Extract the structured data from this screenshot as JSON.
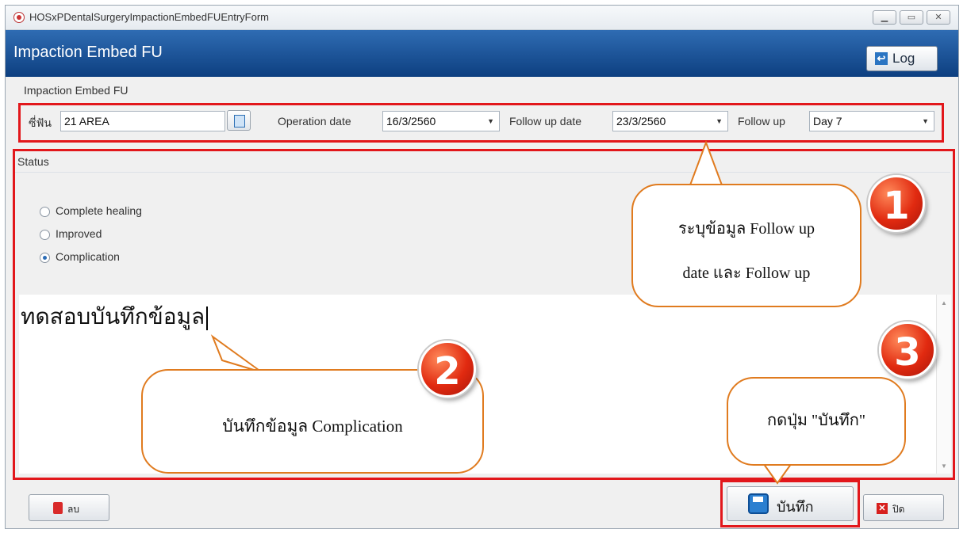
{
  "window": {
    "title": "HOSxPDentalSurgeryImpactionEmbedFUEntryForm"
  },
  "header": {
    "title": "Impaction Embed FU",
    "log_label": "Log"
  },
  "group": {
    "caption": "Impaction Embed FU"
  },
  "fields": {
    "tooth_label": "ซี่ฟัน",
    "tooth_value": "21 AREA",
    "operation_date_label": "Operation date",
    "operation_date_value": "16/3/2560",
    "followup_date_label": "Follow up date",
    "followup_date_value": "23/3/2560",
    "followup_label": "Follow up",
    "followup_value": "Day 7"
  },
  "status": {
    "caption": "Status",
    "options": [
      "Complete healing",
      "Improved",
      "Complication"
    ],
    "selected": "Complication"
  },
  "memo": {
    "text": "ทดสอบบันทึกข้อมูล"
  },
  "buttons": {
    "delete_label": "ลบ",
    "save_label": "บันทึก",
    "close_label": "ปิด"
  },
  "callouts": {
    "c1_line1": "ระบุข้อมูล Follow up",
    "c1_line2": "date และ Follow up",
    "c2_text": "บันทึกข้อมูล Complication",
    "c3_text": "กดปุ่ม \"บันทึก\"",
    "n1": "1",
    "n2": "2",
    "n3": "3"
  },
  "colors": {
    "header_blue": "#1a4f96",
    "highlight_red": "#e2171b",
    "callout_border": "#e07b1f",
    "badge_red": "#e12a10"
  }
}
